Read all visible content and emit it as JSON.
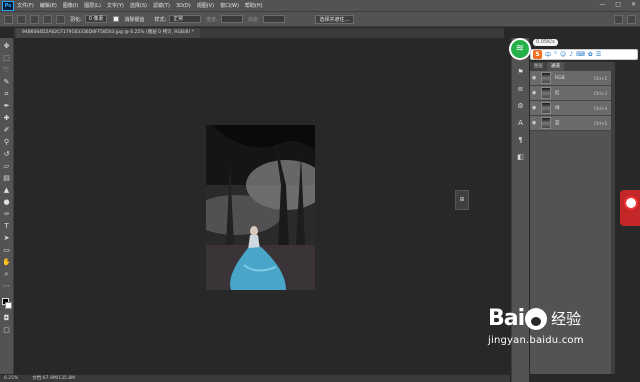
{
  "app": {
    "logo": "Ps",
    "menu": [
      "文件(F)",
      "编辑(E)",
      "图像(I)",
      "图层(L)",
      "文字(Y)",
      "选择(S)",
      "滤镜(T)",
      "3D(D)",
      "视图(V)",
      "窗口(W)",
      "帮助(H)"
    ],
    "window_controls": [
      "—",
      "□",
      "✕"
    ]
  },
  "options_bar": {
    "feather_label": "羽化:",
    "feather_value": "0 像素",
    "antialias_label": "消除锯齿",
    "style_label": "样式:",
    "style_value": "正常",
    "width_label": "宽度:",
    "height_label": "高度:",
    "select_mask_button": "选择并遮住..."
  },
  "document": {
    "tab_title": "9486064D2A62CF179183336D8FF58503.jpg @ 6.25% (图层 0 拷贝, RGB/8) *"
  },
  "status": {
    "zoom": "6.25%",
    "doc_size": "文档:67.9M/135.8M"
  },
  "channels_panel": {
    "tabs": [
      "图层",
      "通道"
    ],
    "active_tab": "通道",
    "rows": [
      {
        "name": "RGB",
        "shortcut": "Ctrl+2"
      },
      {
        "name": "红",
        "shortcut": "Ctrl+3"
      },
      {
        "name": "绿",
        "shortcut": "Ctrl+4"
      },
      {
        "name": "蓝",
        "shortcut": "Ctrl+5"
      }
    ]
  },
  "overlay": {
    "network_speed": "0.05K/s",
    "ime_logo": "S"
  },
  "watermark": {
    "brand": "Bai",
    "brand_suffix": "经验",
    "url": "jingyan.baidu.com"
  },
  "colors": {
    "ui_bg": "#535353",
    "canvas_bg": "#282828",
    "wifi_green": "#26b04a",
    "badge_red": "#c42727"
  }
}
